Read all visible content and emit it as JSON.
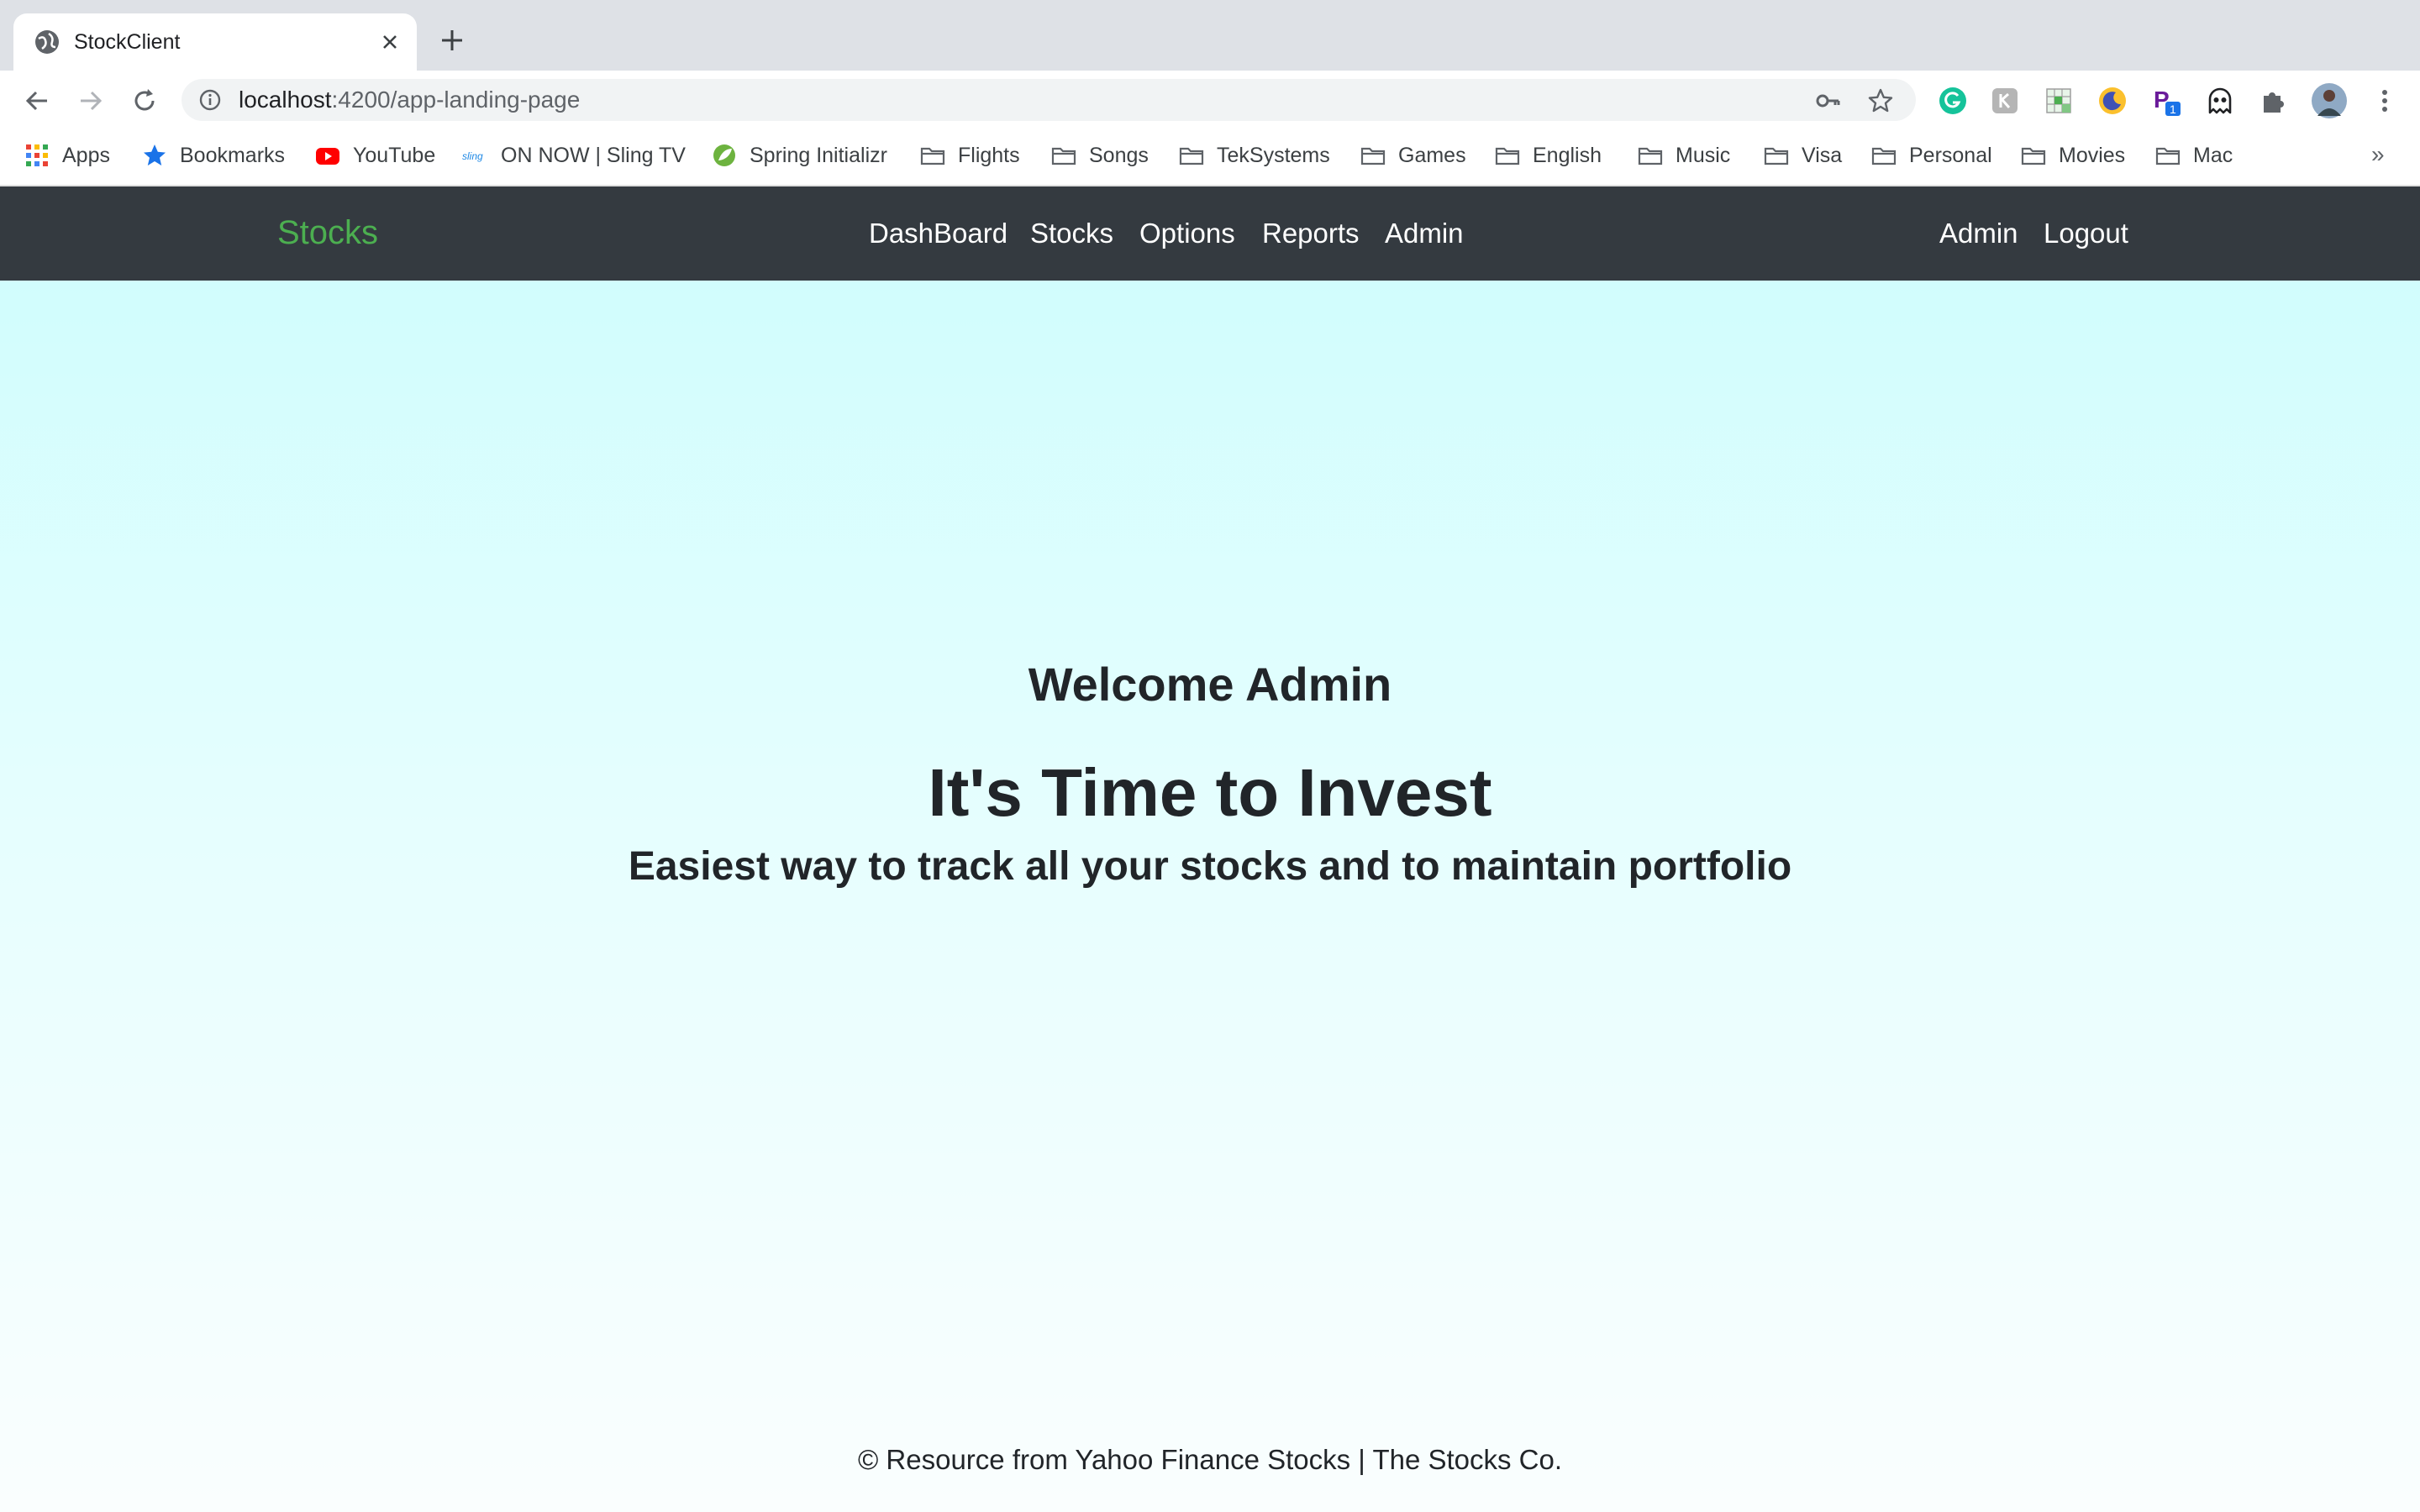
{
  "browser": {
    "tab_title": "StockClient",
    "url_host": "localhost",
    "url_path": ":4200/app-landing-page",
    "extension_badge": "1"
  },
  "bookmarks": [
    {
      "label": "Apps",
      "icon": "apps-grid-icon"
    },
    {
      "label": "Bookmarks",
      "icon": "star-icon"
    },
    {
      "label": "YouTube",
      "icon": "youtube-icon"
    },
    {
      "label": "ON NOW | Sling TV",
      "icon": "sling-icon"
    },
    {
      "label": "Spring Initializr",
      "icon": "spring-icon"
    },
    {
      "label": "Flights",
      "icon": "folder-icon"
    },
    {
      "label": "Songs",
      "icon": "folder-icon"
    },
    {
      "label": "TekSystems",
      "icon": "folder-icon"
    },
    {
      "label": "Games",
      "icon": "folder-icon"
    },
    {
      "label": "English",
      "icon": "folder-icon"
    },
    {
      "label": "Music",
      "icon": "folder-icon"
    },
    {
      "label": "Visa",
      "icon": "folder-icon"
    },
    {
      "label": "Personal",
      "icon": "folder-icon"
    },
    {
      "label": "Movies",
      "icon": "folder-icon"
    },
    {
      "label": "Mac",
      "icon": "folder-icon"
    }
  ],
  "bookmarks_overflow": "»",
  "navbar": {
    "brand": "Stocks",
    "links": [
      "DashBoard",
      "Stocks",
      "Options",
      "Reports",
      "Admin"
    ],
    "right_links": [
      "Admin",
      "Logout"
    ]
  },
  "hero": {
    "welcome": "Welcome Admin",
    "headline": "It's Time to Invest",
    "subline": "Easiest way to track all your stocks and to maintain portfolio"
  },
  "footer": {
    "text": "© Resource from Yahoo Finance Stocks | The Stocks Co."
  },
  "colors": {
    "navbar_bg": "#343a40",
    "brand": "#4caf50",
    "hero_bg_top": "#d1fdfd"
  }
}
